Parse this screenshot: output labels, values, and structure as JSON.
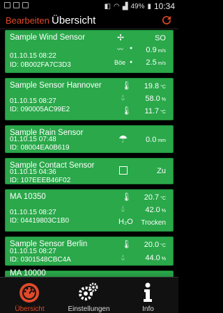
{
  "statusbar": {
    "battery": "49%",
    "time": "10:34"
  },
  "appbar": {
    "edit_label": "Bearbeiten",
    "title": "Übersicht"
  },
  "sensors": [
    {
      "name": "Sample Wind Sensor",
      "date": "01.10.15  08:22",
      "id": "ID: 0B002FA7C3D3",
      "r1_value": "SO",
      "r2_value": "0.9",
      "r2_unit": "m/s",
      "r3_label": "Böe",
      "r3_value": "2.5",
      "r3_unit": "m/s"
    },
    {
      "name": "Sample Sensor Hannover",
      "date": "01.10.15  08:27",
      "id": "ID: 090005AC99E2",
      "r1_value": "19.8",
      "r1_unit": "°C",
      "r2_value": "58.0",
      "r2_unit": "%",
      "r3_value": "11.7",
      "r3_unit": "°C"
    },
    {
      "name": "Sample Rain Sensor",
      "date": "01.10.15  07:48",
      "id": "ID: 08004EA0B619",
      "r1_value": "0.0",
      "r1_unit": "mm"
    },
    {
      "name": "Sample Contact Sensor",
      "date": "01.10.15  04:36",
      "id": "ID: 107EEEB46F02",
      "r1_value": "Zu"
    },
    {
      "name": "MA 10350",
      "date": "01.10.15  08:27",
      "id": "ID: 04419803C1B0",
      "r1_value": "20.7",
      "r1_unit": "°C",
      "r2_value": "42.0",
      "r2_unit": "%",
      "r3_label": "H₂O",
      "r3_value": "Trocken"
    },
    {
      "name": "Sample Sensor Berlin",
      "date": "01.10.15  08:27",
      "id": "ID: 0301548CBC4A",
      "r1_value": "20.0",
      "r1_unit": "°C",
      "r2_value": "44.0",
      "r2_unit": "%"
    },
    {
      "name": "MA 10000"
    }
  ],
  "tabs": [
    {
      "label": "Übersicht",
      "icon": "gauge-icon",
      "active": true
    },
    {
      "label": "Einstellungen",
      "icon": "gears-icon"
    },
    {
      "label": "Info",
      "icon": "info-icon"
    }
  ],
  "colors": {
    "accent": "#e04a2a",
    "card": "#2aa84a"
  }
}
